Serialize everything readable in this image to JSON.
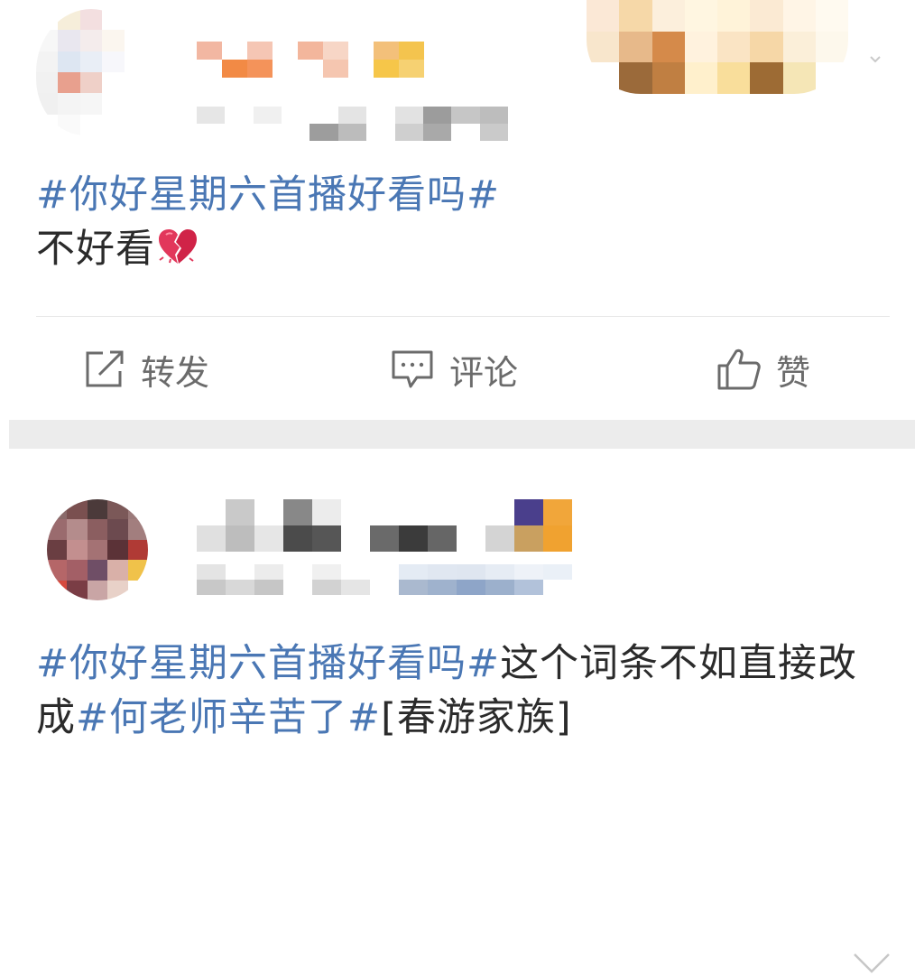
{
  "post1": {
    "hashtag": "#你好星期六首播好看吗#",
    "body": "不好看",
    "emoji": "broken-heart-icon"
  },
  "actions": {
    "repost_label": "转发",
    "comment_label": "评论",
    "like_label": "赞"
  },
  "post2": {
    "hashtag1": "#你好星期六首播好看吗#",
    "text1": "这个词条不如直接改成",
    "hashtag2": "#何老师辛苦了#",
    "text2": "[春游家族]"
  },
  "colors": {
    "hashtag": "#4a77b4",
    "text": "#2b2b2b",
    "action_text": "#6b6b6b",
    "separator": "#ececec"
  },
  "icons": {
    "repost": "repost-icon",
    "comment": "comment-icon",
    "like": "thumbs-up-icon",
    "more": "chevron-down-icon"
  }
}
